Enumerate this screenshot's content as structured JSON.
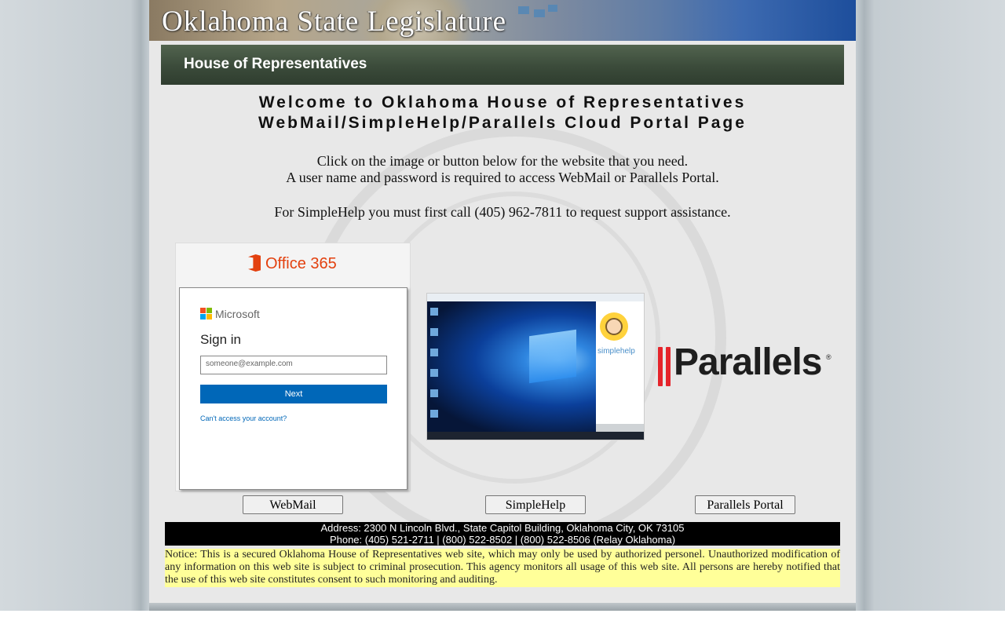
{
  "banner": {
    "title": "Oklahoma State Legislature"
  },
  "section": {
    "title": "House of Representatives"
  },
  "welcome": {
    "line1": "Welcome to Oklahoma House of Representatives",
    "line2": "WebMail/SimpleHelp/Parallels Cloud Portal Page"
  },
  "instructions": {
    "line1": "Click on the image or button below for the website that you need.",
    "line2": "A user name and password is required to access WebMail or Parallels Portal.",
    "line3": "For SimpleHelp you must first call (405) 962-7811 to request support assistance."
  },
  "office365_card": {
    "brand": "Office 365",
    "ms_brand": "Microsoft",
    "heading": "Sign in",
    "email_placeholder": "someone@example.com",
    "next_label": "Next",
    "cant_access": "Can't access your account?",
    "ms_colors": [
      "#f25022",
      "#7fba00",
      "#00a4ef",
      "#ffb900"
    ]
  },
  "simplehelp_card": {
    "brand": "simplehelp"
  },
  "parallels_card": {
    "brand": "Parallels",
    "reg_mark": "®",
    "accent": "#e5242b"
  },
  "buttons": {
    "webmail": "WebMail",
    "simplehelp": "SimpleHelp",
    "parallels": "Parallels Portal"
  },
  "footer": {
    "address": "Address: 2300 N Lincoln Blvd., State Capitol Building, Oklahoma City, OK 73105",
    "phone": "Phone: (405) 521-2711 | (800) 522-8502 | (800) 522-8506 (Relay Oklahoma)"
  },
  "notice": "Notice: This is a secured Oklahoma House of Representatives web site, which may only be used by authorized personel. Unauthorized modification of any information on this web site is subject to criminal prosecution. This agency monitors all usage of this web site. All persons are hereby notified that the use of this web site constitutes consent to such monitoring and auditing."
}
